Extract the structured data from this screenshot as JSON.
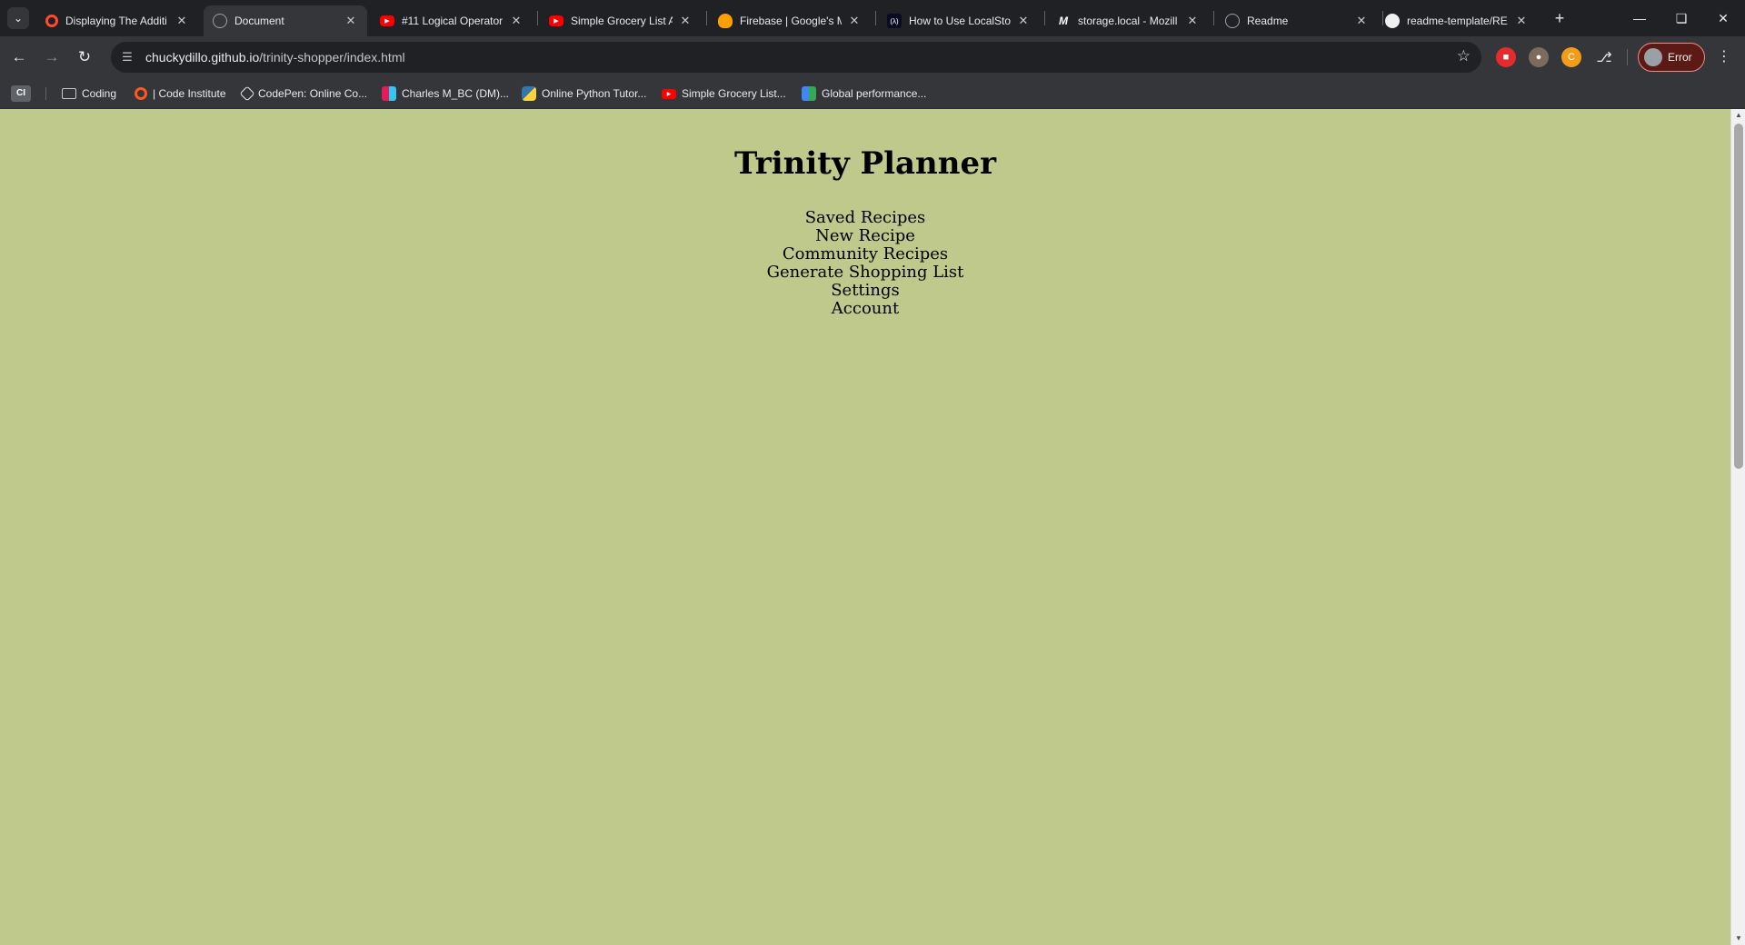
{
  "browser": {
    "tabs": [
      {
        "title": "Displaying The Additi",
        "icon": "opera-icon",
        "active": false
      },
      {
        "title": "Document",
        "icon": "globe-icon",
        "active": true
      },
      {
        "title": "#11 Logical Operator",
        "icon": "youtube-icon",
        "active": false
      },
      {
        "title": "Simple Grocery List A",
        "icon": "youtube-icon",
        "active": false
      },
      {
        "title": "Firebase | Google's M",
        "icon": "firebase-icon",
        "active": false
      },
      {
        "title": "How to Use LocalStor",
        "icon": "freecodecamp-icon",
        "active": false
      },
      {
        "title": "storage.local - Mozill",
        "icon": "mdn-icon",
        "active": false
      },
      {
        "title": "Readme",
        "icon": "globe-icon",
        "active": false
      },
      {
        "title": "readme-template/RE",
        "icon": "github-icon",
        "active": false
      }
    ],
    "url_host": "chuckydillo.github.io",
    "url_path": "/trinity-shopper/index.html",
    "profile_label": "Error",
    "bookmarks": {
      "ci_label": "CI",
      "items": [
        {
          "label": "Coding",
          "icon": "folder-icon"
        },
        {
          "label": "| Code Institute",
          "icon": "code-institute-icon"
        },
        {
          "label": "CodePen: Online Co...",
          "icon": "codepen-icon"
        },
        {
          "label": "Charles M_BC (DM)...",
          "icon": "slack-icon"
        },
        {
          "label": "Online Python Tutor...",
          "icon": "python-icon"
        },
        {
          "label": "Simple Grocery List...",
          "icon": "youtube-icon"
        },
        {
          "label": "Global performance...",
          "icon": "pagespeed-icon"
        }
      ]
    }
  },
  "page": {
    "title": "Trinity Planner",
    "nav": [
      "Saved Recipes",
      "New Recipe",
      "Community Recipes",
      "Generate Shopping List",
      "Settings",
      "Account"
    ],
    "background_color": "#c0c98c"
  }
}
